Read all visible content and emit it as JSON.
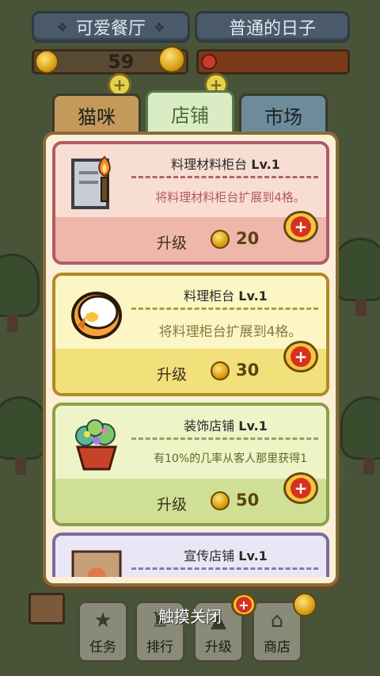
{
  "header": {
    "restaurant_name": "可爱餐厅",
    "day_name": "普通的日子",
    "coins": "59"
  },
  "tabs": [
    {
      "label": "猫咪"
    },
    {
      "label": "店铺"
    },
    {
      "label": "市场"
    }
  ],
  "active_tab": "店铺",
  "cards": [
    {
      "name": "料理材料柜台",
      "level": "Lv.1",
      "desc": "将料理材料柜台扩展到4格。",
      "upgrade_label": "升级",
      "cost": "20",
      "icon": "torch-counter-icon"
    },
    {
      "name": "料理柜台",
      "level": "Lv.1",
      "desc": "将料理柜台扩展到4格。",
      "upgrade_label": "升级",
      "cost": "30",
      "icon": "egg-counter-icon"
    },
    {
      "name": "装饰店铺",
      "level": "Lv.1",
      "desc": "有10%的几率从客人那里获得1",
      "upgrade_label": "升级",
      "cost": "50",
      "icon": "flower-basket-icon"
    },
    {
      "name": "宣传店铺",
      "level": "Lv.1",
      "icon": "promo-stand-icon"
    }
  ],
  "close_hint": "触摸关闭",
  "nav": [
    {
      "label": "任务",
      "icon": "star-icon"
    },
    {
      "label": "排行",
      "icon": "trophy-icon"
    },
    {
      "label": "升级",
      "icon": "upgrade-icon"
    },
    {
      "label": "商店",
      "icon": "basket-icon"
    }
  ],
  "colors": {
    "card1_border": "#b05a6a",
    "card2_border": "#b08a24",
    "card3_border": "#8aa04a",
    "card4_border": "#7a6aa0",
    "badge_red": "#d6321f",
    "coin_gold": "#d9a012"
  }
}
